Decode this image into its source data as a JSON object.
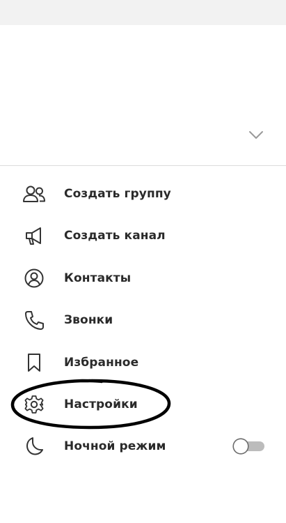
{
  "header": {
    "expand_icon": "chevron-down-icon"
  },
  "menu": {
    "items": [
      {
        "label": "Создать группу",
        "icon": "people-icon"
      },
      {
        "label": "Создать канал",
        "icon": "megaphone-icon"
      },
      {
        "label": "Контакты",
        "icon": "user-circle-icon"
      },
      {
        "label": "Звонки",
        "icon": "phone-icon"
      },
      {
        "label": "Избранное",
        "icon": "bookmark-icon"
      },
      {
        "label": "Настройки",
        "icon": "gear-icon"
      },
      {
        "label": "Ночной режим",
        "icon": "moon-icon",
        "toggle_on": false
      }
    ]
  },
  "annotation": {
    "shape": "hand-drawn-ellipse",
    "color": "#000000",
    "circled_item": "Настройки"
  }
}
